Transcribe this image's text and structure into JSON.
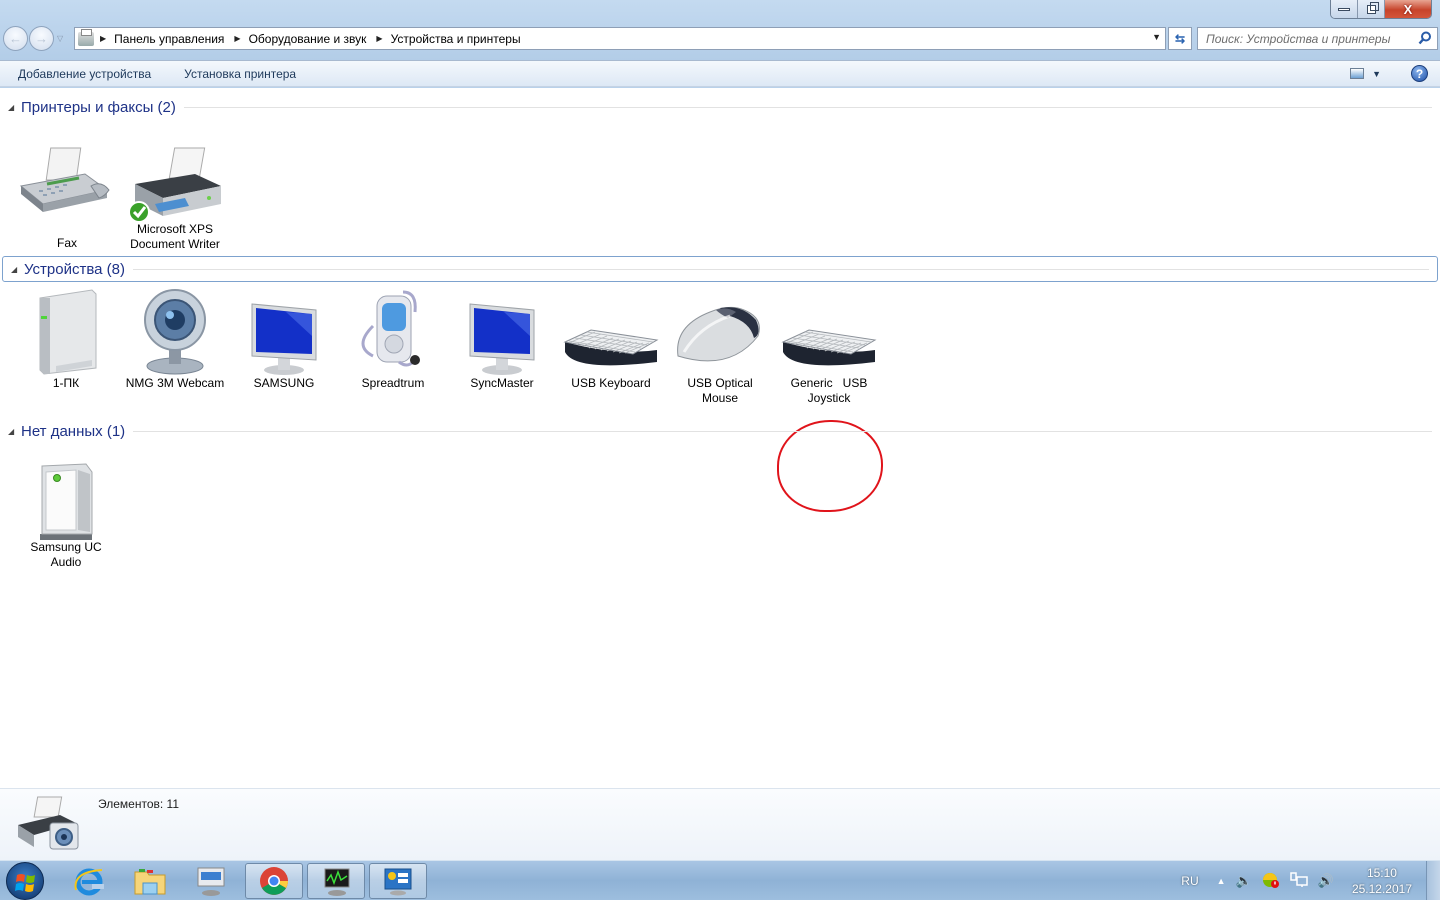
{
  "window": {
    "minimize_label": "—",
    "close_label": "X"
  },
  "address": {
    "crumbs": [
      "Панель управления",
      "Оборудование и звук",
      "Устройства и принтеры"
    ],
    "search_placeholder": "Поиск: Устройства и принтеры"
  },
  "toolbar": {
    "add_device": "Добавление устройства",
    "add_printer": "Установка принтера",
    "help": "?"
  },
  "groups": [
    {
      "title": "Принтеры и факсы (2)",
      "items": [
        {
          "label": "Fax",
          "icon": "fax-icon"
        },
        {
          "label": "Microsoft XPS Document Writer",
          "icon": "printer-icon",
          "default": true
        }
      ]
    },
    {
      "title": "Устройства (8)",
      "items": [
        {
          "label": "1-ПК",
          "icon": "computer-icon"
        },
        {
          "label": "NMG 3M Webcam",
          "icon": "webcam-icon"
        },
        {
          "label": "SAMSUNG",
          "icon": "monitor-icon"
        },
        {
          "label": "Spreadtrum",
          "icon": "media-player-icon"
        },
        {
          "label": "SyncMaster",
          "icon": "monitor-icon"
        },
        {
          "label": "USB Keyboard",
          "icon": "keyboard-icon"
        },
        {
          "label": "USB Optical Mouse",
          "icon": "mouse-icon"
        },
        {
          "label": "Generic   USB Joystick",
          "icon": "keyboard-icon",
          "highlighted": true
        }
      ]
    },
    {
      "title": "Нет данных (1)",
      "items": [
        {
          "label": "Samsung UC Audio",
          "icon": "generic-device-icon"
        }
      ]
    }
  ],
  "status": {
    "text": "Элементов: 11"
  },
  "taskbar": {
    "apps": [
      "internet-explorer",
      "windows-explorer",
      "devices-and-printers",
      "chrome",
      "resource-monitor",
      "control-panel"
    ],
    "lang": "RU",
    "time": "15:10",
    "date": "25.12.2017"
  },
  "colors": {
    "group_title": "#1e3287",
    "highlight_circle": "#e0141b",
    "title_bar": "#b9d1ea"
  }
}
